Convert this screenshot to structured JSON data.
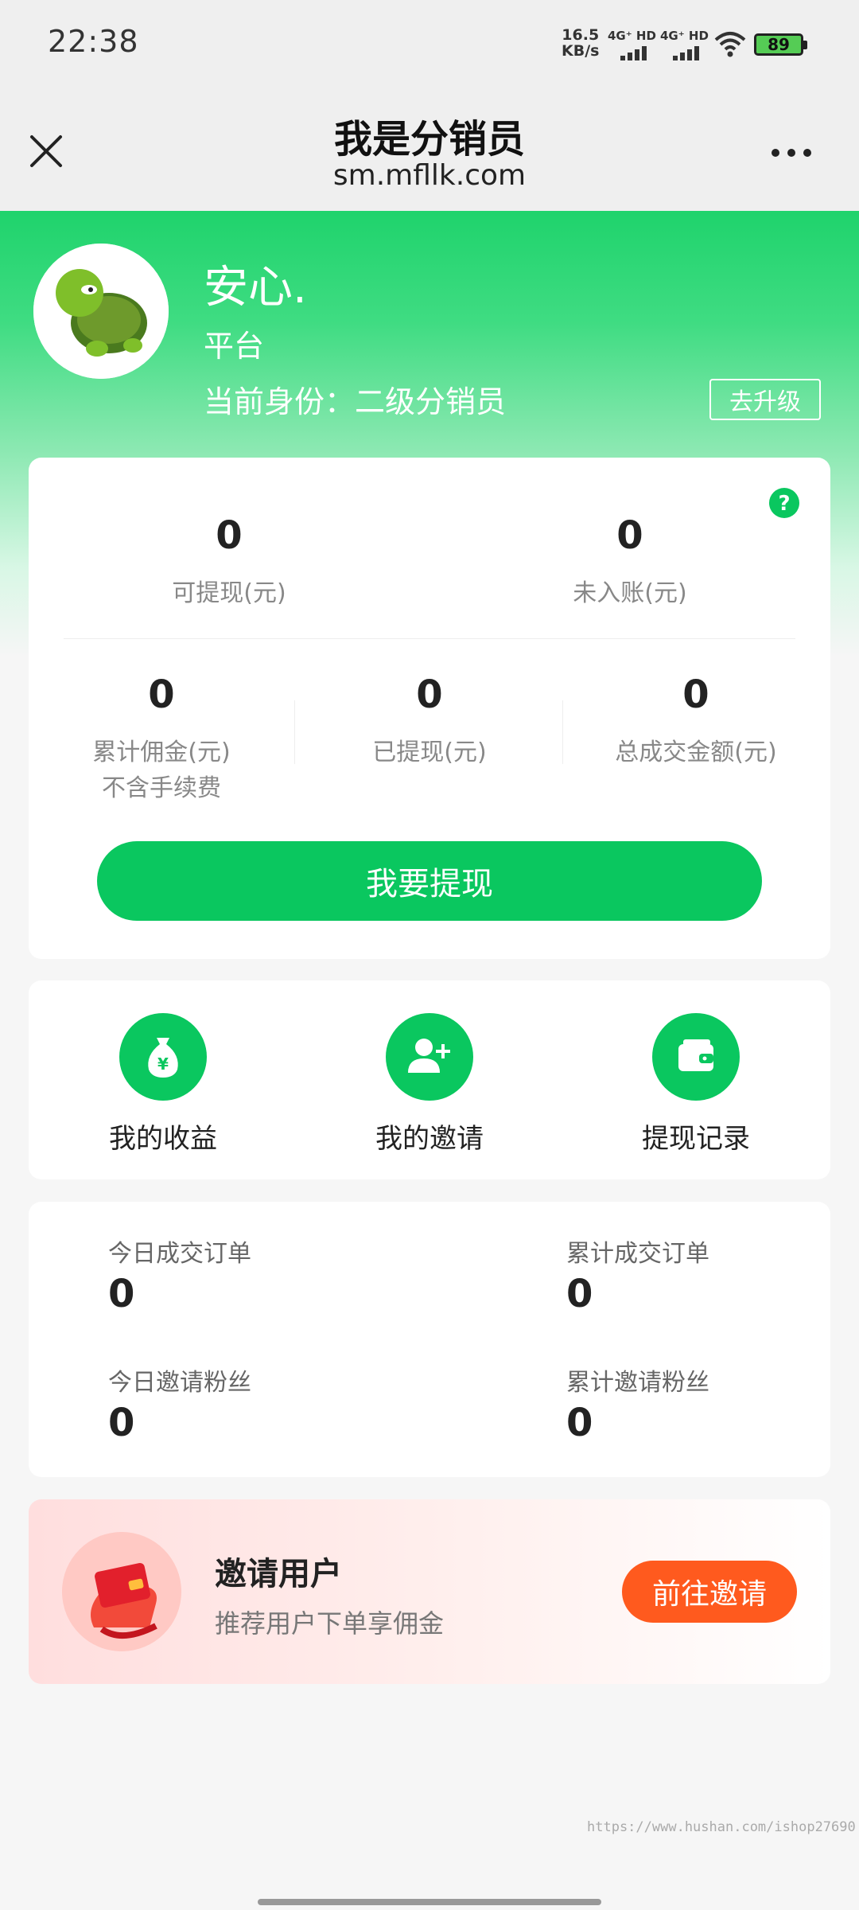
{
  "status_bar": {
    "time": "22:38",
    "net_speed_value": "16.5",
    "net_speed_unit": "KB/s",
    "signal1_label": "4G⁺ HD",
    "signal2_label": "4G⁺ HD",
    "battery_level": "89",
    "icons": [
      "wifi-icon",
      "battery-icon"
    ]
  },
  "nav": {
    "title": "我是分销员",
    "subtitle": "sm.mfllk.com",
    "icons": [
      "close-icon",
      "more-icon"
    ]
  },
  "profile": {
    "name": "安心.",
    "platform": "平台",
    "role": "当前身份：二级分销员",
    "upgrade_label": "去升级"
  },
  "earnings": {
    "available": {
      "value": "0",
      "label": "可提现(元)"
    },
    "pending": {
      "value": "0",
      "label": "未入账(元)"
    },
    "total_commission": {
      "value": "0",
      "label": "累计佣金(元)",
      "note": "不含手续费"
    },
    "withdrawn": {
      "value": "0",
      "label": "已提现(元)"
    },
    "total_amount": {
      "value": "0",
      "label": "总成交金额(元)"
    },
    "withdraw_button": "我要提现",
    "help_icon": "question-icon"
  },
  "functions": [
    {
      "label": "我的收益",
      "icon": "money-bag-icon"
    },
    {
      "label": "我的邀请",
      "icon": "add-user-icon"
    },
    {
      "label": "提现记录",
      "icon": "wallet-icon"
    }
  ],
  "stats": {
    "today_orders": {
      "label": "今日成交订单",
      "value": "0"
    },
    "total_orders": {
      "label": "累计成交订单",
      "value": "0"
    },
    "today_fans": {
      "label": "今日邀请粉丝",
      "value": "0"
    },
    "total_fans": {
      "label": "累计邀请粉丝",
      "value": "0"
    }
  },
  "invite": {
    "title": "邀请用户",
    "subtitle": "推荐用户下单享佣金",
    "button": "前往邀请"
  },
  "watermark": "https://www.hushan.com/ishop27690",
  "colors": {
    "primary": "#0ac75f",
    "accent": "#ff5a1e"
  }
}
